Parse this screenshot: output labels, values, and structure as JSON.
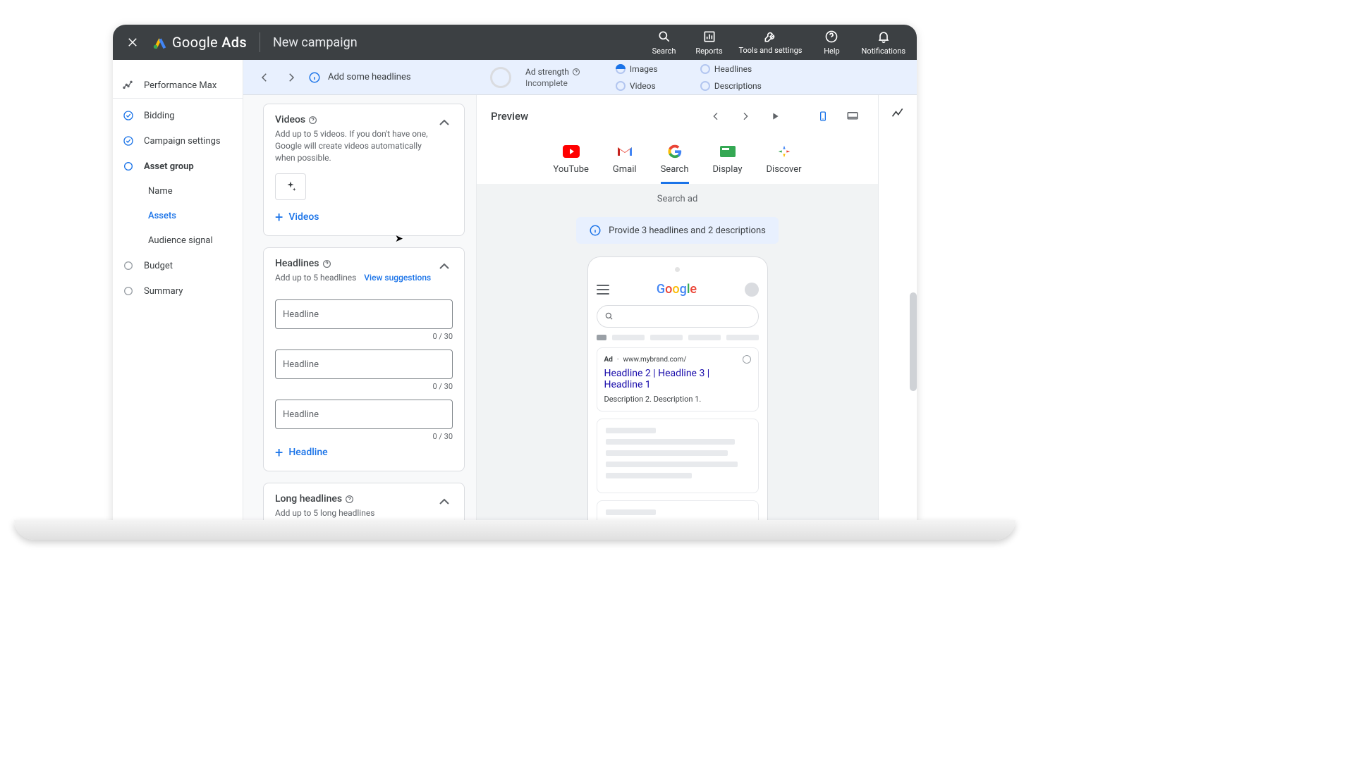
{
  "topbar": {
    "brand": "Google",
    "product": "Ads",
    "page_title": "New campaign",
    "actions": {
      "search": "Search",
      "reports": "Reports",
      "tools": "Tools and settings",
      "help": "Help",
      "notifications": "Notifications"
    }
  },
  "sidebar": {
    "campaign_type": "Performance Max",
    "steps": {
      "bidding": "Bidding",
      "campaign_settings": "Campaign settings",
      "asset_group": "Asset group",
      "budget": "Budget",
      "summary": "Summary"
    },
    "asset_group_subs": {
      "name": "Name",
      "assets": "Assets",
      "audience_signal": "Audience signal"
    }
  },
  "strength": {
    "tip": "Add some headlines",
    "label": "Ad strength",
    "status": "Incomplete",
    "checks": {
      "images": "Images",
      "headlines": "Headlines",
      "videos": "Videos",
      "descriptions": "Descriptions"
    }
  },
  "form": {
    "videos": {
      "title": "Videos",
      "desc": "Add up to 5 videos. If you don't have one, Google will create videos automatically when possible.",
      "add": "Videos"
    },
    "headlines": {
      "title": "Headlines",
      "desc": "Add up to 5 headlines",
      "suggestions": "View suggestions",
      "placeholder": "Headline",
      "count": "0 / 30",
      "add": "Headline"
    },
    "long_headlines": {
      "title": "Long headlines",
      "desc": "Add up to 5 long headlines"
    }
  },
  "preview": {
    "title": "Preview",
    "tabs": {
      "youtube": "YouTube",
      "gmail": "Gmail",
      "search": "Search",
      "display": "Display",
      "discover": "Discover"
    },
    "body_label": "Search ad",
    "info_message": "Provide 3 headlines and 2 descriptions",
    "ad": {
      "tag": "Ad",
      "dot": "·",
      "url": "www.mybrand.com/",
      "headline": "Headline 2 | Headline 3 | Headline 1",
      "description": "Description 2. Description 1."
    }
  }
}
